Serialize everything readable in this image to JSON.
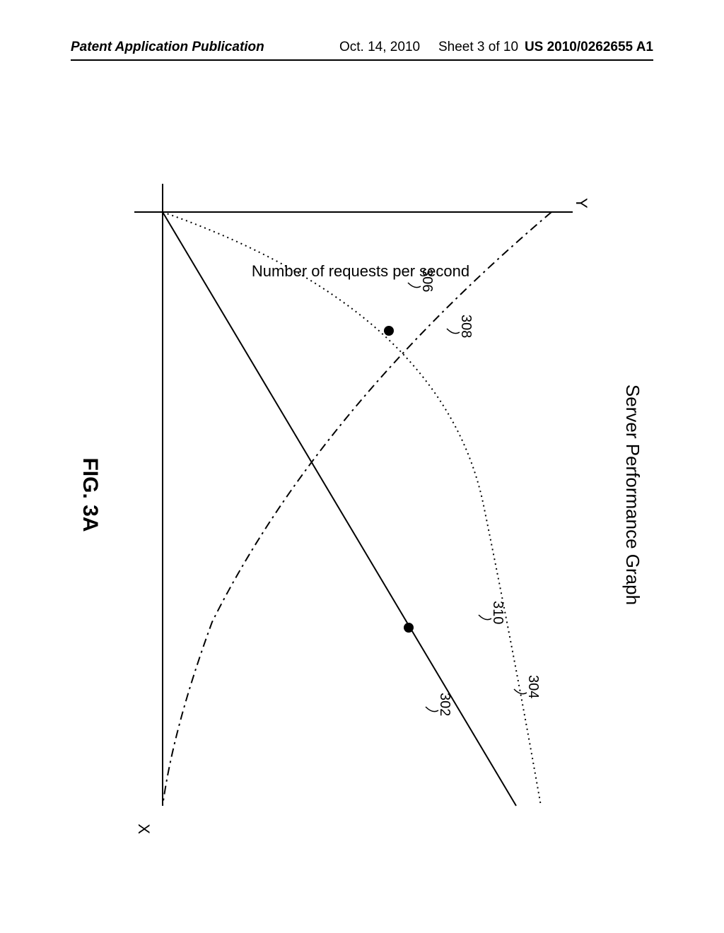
{
  "header": {
    "left": "Patent Application Publication",
    "date": "Oct. 14, 2010",
    "sheet": "Sheet 3 of 10",
    "pubno": "US 2010/0262655 A1"
  },
  "figure": {
    "title": "Server Performance Graph",
    "ylabel": "Number of requests per second",
    "y_axis_letter": "Y",
    "x_axis_letter": "X",
    "caption": "FIG. 3A",
    "refs": {
      "r302": "302",
      "r304": "304",
      "r306": "306",
      "r308": "308",
      "r310": "310"
    }
  },
  "chart_data": {
    "type": "line",
    "title": "Server Performance Graph",
    "xlabel": "",
    "ylabel": "Number of requests per second",
    "xlim": [
      0,
      100
    ],
    "ylim": [
      0,
      100
    ],
    "series": [
      {
        "name": "302",
        "style": "solid",
        "x": [
          0,
          100
        ],
        "values": [
          0,
          86
        ]
      },
      {
        "name": "304",
        "style": "dotted",
        "x": [
          0,
          10,
          20,
          30,
          40,
          50,
          60,
          70,
          80,
          90,
          100
        ],
        "values": [
          0,
          38,
          55,
          65,
          72,
          76,
          78,
          80,
          82,
          85,
          92
        ]
      },
      {
        "name": "306",
        "style": "dash-dot",
        "x": [
          0,
          10,
          20,
          30,
          40,
          50,
          60,
          70,
          80,
          90,
          100
        ],
        "values": [
          95,
          75,
          58,
          44,
          33,
          24,
          17,
          11,
          7,
          3,
          0
        ]
      }
    ],
    "points": [
      {
        "name": "308",
        "x": 20,
        "y": 55
      },
      {
        "name": "310",
        "x": 70,
        "y": 60
      }
    ]
  }
}
